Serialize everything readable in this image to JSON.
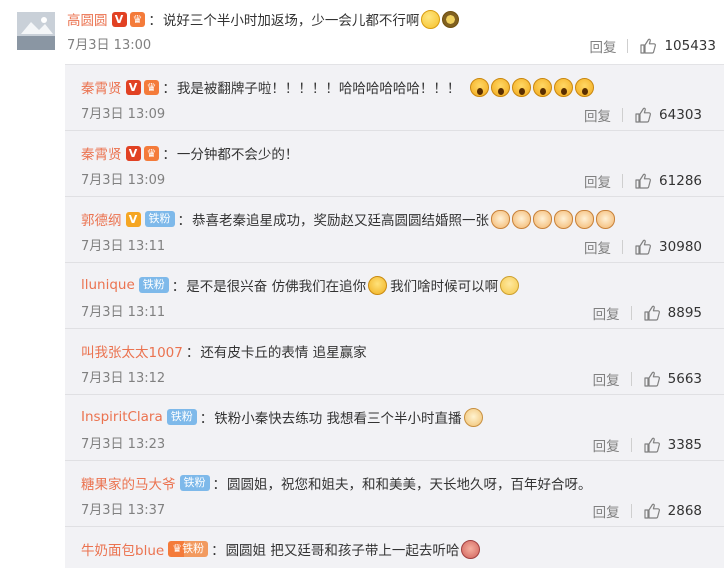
{
  "main_comment": {
    "author": "高圆圆",
    "badges": [
      "verified-red-v-icon",
      "crown-badge-icon"
    ],
    "text": "说好三个半小时加返场，少一会儿都不行啊",
    "emojis": [
      "smile",
      "bee"
    ],
    "time": "7月3日 13:00",
    "reply_label": "回复",
    "likes": "105433"
  },
  "replies": [
    {
      "author": "秦霄贤",
      "badges": [
        "verified-red-v-icon",
        "crown-badge-icon"
      ],
      "text": "我是被翻牌子啦！！！！！哈哈哈哈哈哈！！！",
      "emojis": [
        "shock",
        "shock",
        "shock",
        "shock",
        "shock",
        "shock"
      ],
      "time": "7月3日 13:09",
      "reply_label": "回复",
      "likes": "64303"
    },
    {
      "author": "秦霄贤",
      "badges": [
        "verified-red-v-icon",
        "crown-badge-icon"
      ],
      "text": "一分钟都不会少的！",
      "emojis": [],
      "time": "7月3日 13:09",
      "reply_label": "回复",
      "likes": "61286"
    },
    {
      "author": "郭德纲",
      "badges": [
        "verified-gold-v-icon",
        "iron-fan-badge"
      ],
      "fan_badge": "铁粉",
      "text": "恭喜老秦追星成功，奖励赵又廷高圆圆结婚照一张",
      "emojis": [
        "cat",
        "cat",
        "cat",
        "cat",
        "cat",
        "cat"
      ],
      "time": "7月3日 13:11",
      "reply_label": "回复",
      "likes": "30980"
    },
    {
      "author": "llunique",
      "badges": [
        "iron-fan-badge"
      ],
      "fan_badge": "铁粉",
      "text": "是不是很兴奋  仿佛我们在追你",
      "text2": "我们啥时候可以啊",
      "emojis": [
        "cry"
      ],
      "emojis2": [
        "think"
      ],
      "time": "7月3日 13:11",
      "reply_label": "回复",
      "likes": "8895"
    },
    {
      "author": "叫我张太太1007",
      "badges": [],
      "text": "还有皮卡丘的表情  追星赢家",
      "emojis": [],
      "time": "7月3日 13:12",
      "reply_label": "回复",
      "likes": "5663"
    },
    {
      "author": "InspiritClara",
      "badges": [
        "iron-fan-badge"
      ],
      "fan_badge": "铁粉",
      "text": "铁粉小秦快去练功 我想看三个半小时直播",
      "emojis": [
        "dog"
      ],
      "time": "7月3日 13:23",
      "reply_label": "回复",
      "likes": "3385"
    },
    {
      "author": "糖果家的马大爷",
      "badges": [
        "iron-fan-badge"
      ],
      "fan_badge": "铁粉",
      "text": "圆圆姐，祝您和姐夫，和和美美，天长地久呀，百年好合呀。",
      "emojis": [],
      "time": "7月3日 13:37",
      "reply_label": "回复",
      "likes": "2868"
    },
    {
      "author": "牛奶面包blue",
      "badges": [
        "crown-iron-fan-badge"
      ],
      "fan_badge": "铁粉",
      "text": "圆圆姐 把又廷哥和孩子带上一起去听哈",
      "emojis": [
        "doll"
      ],
      "time": "",
      "reply_label": "",
      "likes": ""
    }
  ],
  "colors": {
    "username": "#eb7350",
    "meta_gray": "#808080",
    "reply_bg": "#f2f2f5",
    "fan_badge": "#7eb9ea",
    "v_red": "#e14123",
    "v_gold": "#f5a623"
  }
}
